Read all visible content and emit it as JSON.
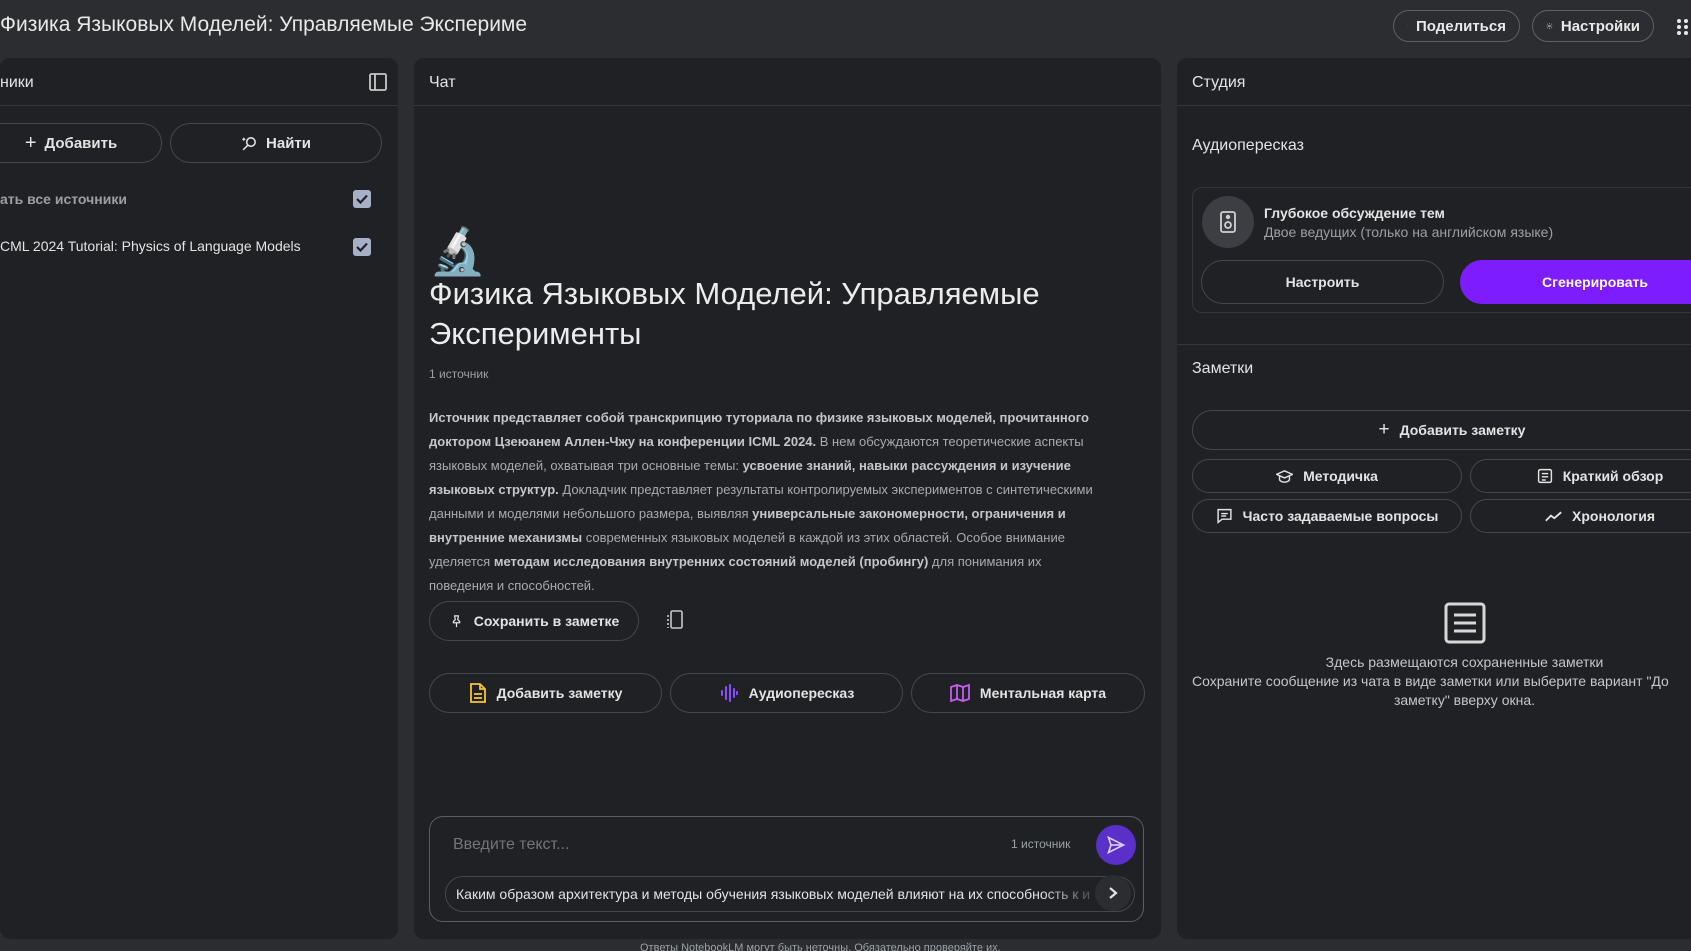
{
  "header": {
    "title": "Физика Языковых Моделей: Управляемые Эксперименты",
    "share_label": "Поделиться",
    "settings_label": "Настройки"
  },
  "sources": {
    "title": "ники",
    "add_label": "Добавить",
    "find_label": "Найти",
    "select_all_label": "ать все источники",
    "items": [
      {
        "label": "CML 2024 Tutorial: Physics of Language Models"
      }
    ]
  },
  "chat": {
    "title": "Чат",
    "notebook_emoji": "🔬",
    "notebook_title": "Физика Языковых Моделей: Управляемые Эксперименты",
    "source_count": "1 источник",
    "summary": [
      {
        "t": "Источник представляет собой транскрипцию туториала по физике языковых моделей, прочитанного доктором Цзеюанем Аллен-Чжу на конференции ICML 2024.",
        "b": true
      },
      {
        "t": " В нем обсуждаются теоретические аспекты языковых моделей, охватывая три основные темы: ",
        "b": false
      },
      {
        "t": "усвоение знаний, навыки рассуждения и изучение языковых структур.",
        "b": true
      },
      {
        "t": " Докладчик представляет результаты контролируемых экспериментов с синтетическими данными и моделями небольшого размера, выявляя ",
        "b": false
      },
      {
        "t": "универсальные закономерности, ограничения и внутренние механизмы",
        "b": true
      },
      {
        "t": " современных языковых моделей в каждой из этих областей. Особое внимание уделяется ",
        "b": false
      },
      {
        "t": "методам исследования внутренних состояний моделей (пробингу)",
        "b": true
      },
      {
        "t": " для понимания их поведения и способностей.",
        "b": false
      }
    ],
    "save_note_label": "Сохранить в заметке",
    "actions": {
      "add_note": "Добавить заметку",
      "audio": "Аудиопересказ",
      "mindmap": "Ментальная карта"
    },
    "input_placeholder": "Введите текст...",
    "input_source_count": "1 источник",
    "suggestion": "Каким образом архитектура и методы обучения языковых моделей влияют на их способность к и",
    "footer_note": "Ответы NotebookLM могут быть неточны. Обязательно проверяйте их."
  },
  "studio": {
    "title": "Студия",
    "audio_section": "Аудиопересказ",
    "audio_card_title": "Глубокое обсуждение тем",
    "audio_card_subtitle": "Двое ведущих (только на английском языке)",
    "customize_label": "Настроить",
    "generate_label": "Сгенерировать",
    "notes_section": "Заметки",
    "add_note_label": "Добавить заметку",
    "note_types": {
      "study_guide": "Методичка",
      "briefing": "Краткий обзор",
      "faq": "Часто задаваемые вопросы",
      "timeline": "Хронология"
    },
    "empty_title": "Здесь размещаются сохраненные заметки",
    "empty_line1": "Сохраните сообщение из чата в виде заметки или выберите вариант \"До",
    "empty_line2": "заметку\" вверху окна."
  },
  "colors": {
    "background": "#2c2d30",
    "panel": "#202124",
    "accent_purple": "#7c1cff",
    "send_button": "#5b2fc9",
    "note_icon": "#f9c430",
    "mindmap_icon": "#c85cf0"
  }
}
